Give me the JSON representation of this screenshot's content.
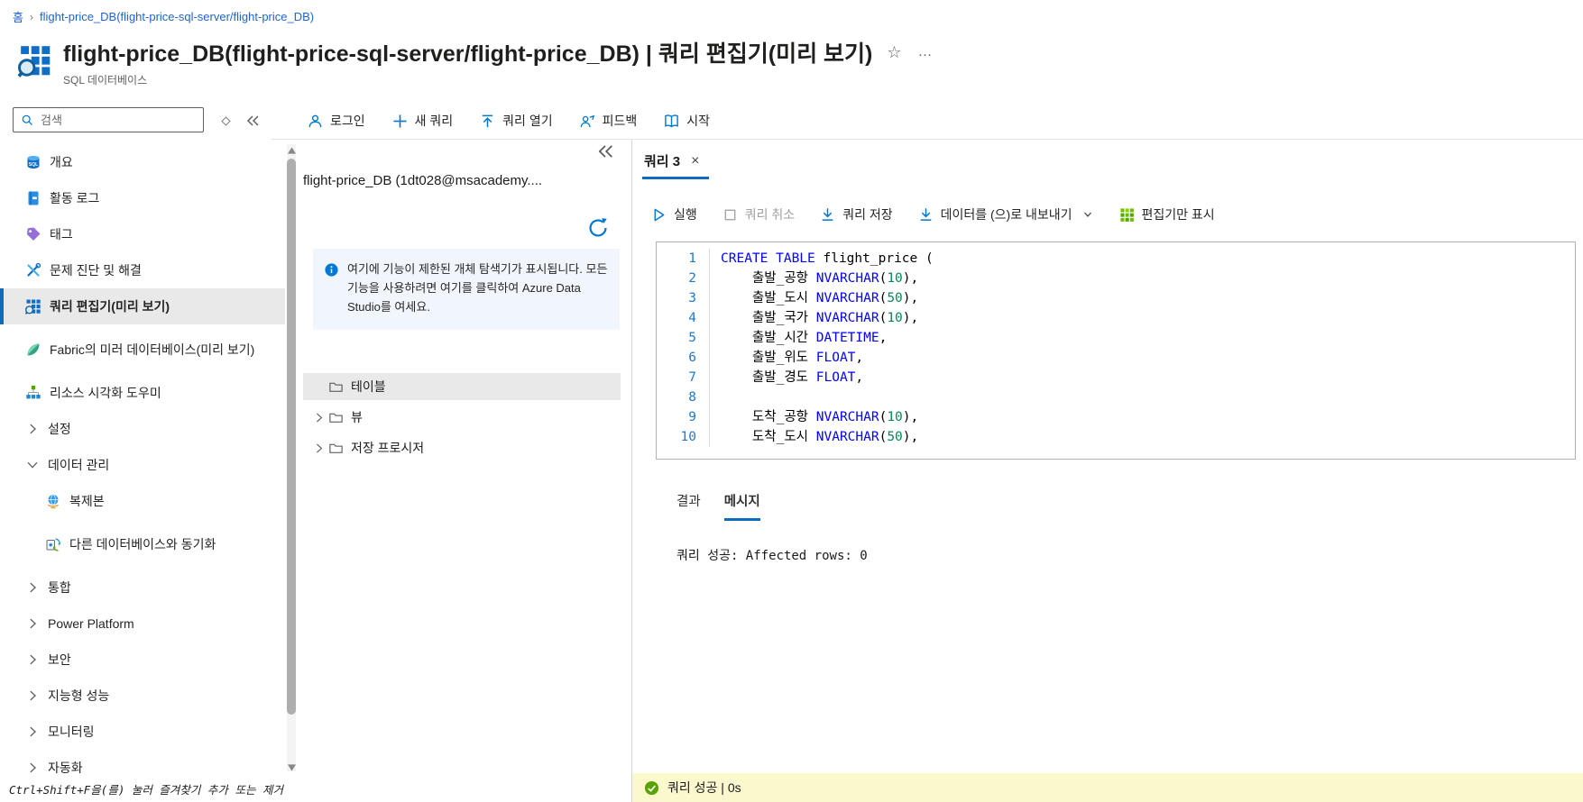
{
  "breadcrumb": {
    "home": "홈",
    "separator": "›",
    "current": "flight-price_DB(flight-price-sql-server/flight-price_DB)"
  },
  "header": {
    "title": "flight-price_DB(flight-price-sql-server/flight-price_DB) | 쿼리 편집기(미리 보기)",
    "subtitle": "SQL 데이터베이스",
    "star": "☆",
    "more": "…"
  },
  "search": {
    "placeholder": "검색"
  },
  "command_bar": {
    "items": [
      {
        "name": "signin-button",
        "icon": "person-icon",
        "label": "로그인"
      },
      {
        "name": "new-query-button",
        "icon": "plus-icon",
        "label": "새 쿼리"
      },
      {
        "name": "open-query-button",
        "icon": "open-query-icon",
        "label": "쿼리 열기"
      },
      {
        "name": "feedback-button",
        "icon": "feedback-icon",
        "label": "피드백"
      },
      {
        "name": "start-button",
        "icon": "book-icon",
        "label": "시작"
      }
    ]
  },
  "sidebar": {
    "items": [
      {
        "label": "개요",
        "icon": "sql-database-icon"
      },
      {
        "label": "활동 로그",
        "icon": "activity-log-icon"
      },
      {
        "label": "태그",
        "icon": "tag-icon"
      },
      {
        "label": "문제 진단 및 해결",
        "icon": "diagnose-icon"
      },
      {
        "label": "쿼리 편집기(미리 보기)",
        "icon": "query-editor-icon",
        "active": true
      },
      {
        "label": "Fabric의 미러 데이터베이스(미리 보기)",
        "icon": "fabric-icon",
        "twoLine": true
      },
      {
        "label": "리소스 시각화 도우미",
        "icon": "resource-visualizer-icon"
      },
      {
        "label": "설정",
        "chevron": "right"
      },
      {
        "label": "데이터 관리",
        "chevron": "down"
      },
      {
        "label": "복제본",
        "icon": "globe-icon",
        "indent": true
      },
      {
        "label": "다른 데이터베이스와 동기화",
        "icon": "sync-icon",
        "indent": true,
        "twoLine": true
      },
      {
        "label": "통합",
        "chevron": "right"
      },
      {
        "label": "Power Platform",
        "chevron": "right"
      },
      {
        "label": "보안",
        "chevron": "right"
      },
      {
        "label": "지능형 성능",
        "chevron": "right"
      },
      {
        "label": "모니터링",
        "chevron": "right"
      },
      {
        "label": "자동화",
        "chevron": "right"
      }
    ],
    "footer_hint": "Ctrl+Shift+F을(를) 눌러 즐겨찾기 추가 또는 제거"
  },
  "explorer": {
    "title": "flight-price_DB (1dt028@msacademy....",
    "info_text": "여기에 기능이 제한된 개체 탐색기가 표시됩니다. 모든 기능을 사용하려면 여기를 클릭하여 Azure Data Studio를 여세요.",
    "tree": [
      {
        "name": "tree-item-tables",
        "label": "테이블",
        "selected": true,
        "chevron": false
      },
      {
        "name": "tree-item-views",
        "label": "뷰",
        "chevron": true
      },
      {
        "name": "tree-item-stored-procedures",
        "label": "저장 프로시저",
        "chevron": true
      }
    ]
  },
  "query": {
    "tab_label": "쿼리 3",
    "tab_close": "×",
    "toolbar": [
      {
        "name": "run-button",
        "icon": "play-icon",
        "label": "실행"
      },
      {
        "name": "cancel-query-button",
        "icon": "stop-icon",
        "label": "쿼리 취소",
        "disabled": true
      },
      {
        "name": "save-query-button",
        "icon": "download-icon",
        "label": "쿼리 저장"
      },
      {
        "name": "export-data-button",
        "icon": "download-icon",
        "label": "데이터를 (으)로 내보내기",
        "dropdown": true
      },
      {
        "name": "editor-only-button",
        "icon": "editor-grid-icon",
        "label": "편집기만 표시"
      }
    ],
    "code_lines": [
      {
        "n": "1",
        "segs": [
          [
            "kw",
            "CREATE TABLE"
          ],
          [
            "pl",
            " flight_price ("
          ]
        ]
      },
      {
        "n": "2",
        "segs": [
          [
            "pl",
            "    출발_공항 "
          ],
          [
            "kw",
            "NVARCHAR"
          ],
          [
            "pl",
            "("
          ],
          [
            "num",
            "10"
          ],
          [
            "pl",
            "),"
          ]
        ]
      },
      {
        "n": "3",
        "segs": [
          [
            "pl",
            "    출발_도시 "
          ],
          [
            "kw",
            "NVARCHAR"
          ],
          [
            "pl",
            "("
          ],
          [
            "num",
            "50"
          ],
          [
            "pl",
            "),"
          ]
        ]
      },
      {
        "n": "4",
        "segs": [
          [
            "pl",
            "    출발_국가 "
          ],
          [
            "kw",
            "NVARCHAR"
          ],
          [
            "pl",
            "("
          ],
          [
            "num",
            "10"
          ],
          [
            "pl",
            "),"
          ]
        ]
      },
      {
        "n": "5",
        "segs": [
          [
            "pl",
            "    출발_시간 "
          ],
          [
            "kw",
            "DATETIME"
          ],
          [
            "pl",
            ","
          ]
        ]
      },
      {
        "n": "6",
        "segs": [
          [
            "pl",
            "    출발_위도 "
          ],
          [
            "kw",
            "FLOAT"
          ],
          [
            "pl",
            ","
          ]
        ]
      },
      {
        "n": "7",
        "segs": [
          [
            "pl",
            "    출발_경도 "
          ],
          [
            "kw",
            "FLOAT"
          ],
          [
            "pl",
            ","
          ]
        ]
      },
      {
        "n": "8",
        "segs": []
      },
      {
        "n": "9",
        "segs": [
          [
            "pl",
            "    도착_공항 "
          ],
          [
            "kw",
            "NVARCHAR"
          ],
          [
            "pl",
            "("
          ],
          [
            "num",
            "10"
          ],
          [
            "pl",
            "),"
          ]
        ]
      },
      {
        "n": "10",
        "segs": [
          [
            "pl",
            "    도착_도시 "
          ],
          [
            "kw",
            "NVARCHAR"
          ],
          [
            "pl",
            "("
          ],
          [
            "num",
            "50"
          ],
          [
            "pl",
            "),"
          ]
        ]
      }
    ],
    "results_tabs": [
      {
        "name": "tab-results",
        "label": "결과"
      },
      {
        "name": "tab-messages",
        "label": "메시지",
        "active": true
      }
    ],
    "message": "쿼리 성공: Affected rows: 0",
    "status_text": "쿼리 성공 | 0s"
  },
  "colors": {
    "accent_blue": "#0f6cbd",
    "keyword_blue": "#0101fd",
    "number_green": "#098658",
    "status_yellow": "#fbf8ce",
    "success_green": "#57a300"
  }
}
